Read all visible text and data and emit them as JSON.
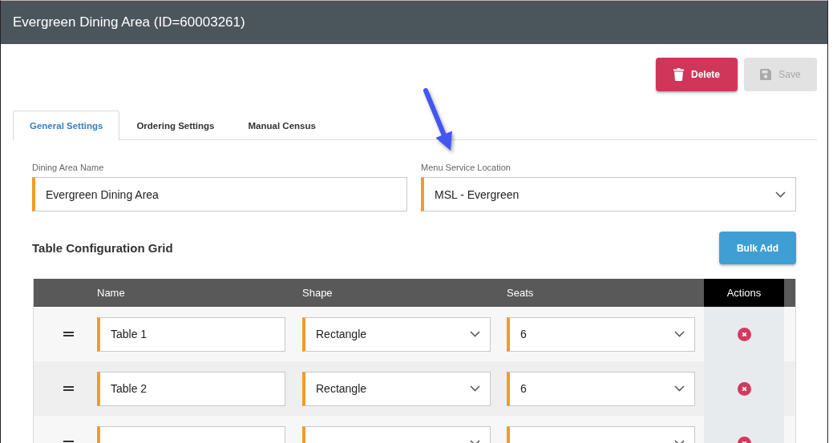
{
  "window": {
    "title": "Evergreen Dining Area (ID=60003261)"
  },
  "actions": [
    {
      "kind": "delete",
      "label": "Delete",
      "disabled": false
    },
    {
      "kind": "save",
      "label": "Save",
      "disabled": true
    }
  ],
  "tabs": [
    {
      "label": "General Settings",
      "selected": true
    },
    {
      "label": "Ordering Settings",
      "selected": false
    },
    {
      "label": "Manual Census",
      "selected": false
    }
  ],
  "fields": [
    {
      "kind": "text",
      "label": "Dining Area Name",
      "value": "Evergreen Dining Area",
      "required": true
    },
    {
      "kind": "select",
      "label": "Menu Service Location",
      "value": "MSL - Evergreen",
      "required": true
    }
  ],
  "grid": {
    "title": "Table Configuration Grid",
    "bulk_button": "Bulk Add",
    "columns": [
      {
        "label": "Name",
        "kind": "text",
        "required": true,
        "highlighted": false
      },
      {
        "label": "Shape",
        "kind": "select",
        "required": true,
        "highlighted": false
      },
      {
        "label": "Seats",
        "kind": "select",
        "required": true,
        "highlighted": false
      },
      {
        "label": "Actions",
        "kind": "action",
        "highlighted": true
      }
    ],
    "rows": [
      {
        "cells": [
          "Table 1",
          "Rectangle",
          "6"
        ]
      },
      {
        "cells": [
          "Table 2",
          "Rectangle",
          "6"
        ]
      },
      {}
    ]
  }
}
